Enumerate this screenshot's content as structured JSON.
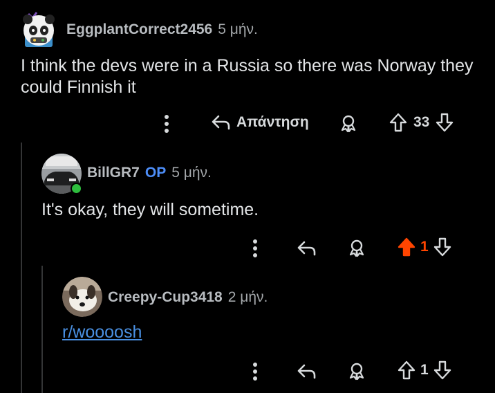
{
  "comments": [
    {
      "username": "EggplantCorrect2456",
      "time": "5 μήν.",
      "body": "I think the devs were in a Russia so there was Norway they could Finnish it",
      "reply_label": "Απάντηση",
      "votes": "33"
    },
    {
      "username": "BillGR7",
      "op_badge": "OP",
      "time": "5 μήν.",
      "body": "It's okay, they will sometime.",
      "votes": "1",
      "upvoted": true
    },
    {
      "username": "Creepy-Cup3418",
      "time": "2 μήν.",
      "link": "r/woooosh",
      "votes": "1"
    }
  ],
  "colors": {
    "background": "#000000",
    "upvote_active": "#ff4500",
    "op": "#4d8df7",
    "link": "#4a90e2",
    "online": "#2ebd3e"
  },
  "icons": [
    "more-icon",
    "reply-arrow-icon",
    "award-icon",
    "upvote-icon",
    "downvote-icon"
  ]
}
